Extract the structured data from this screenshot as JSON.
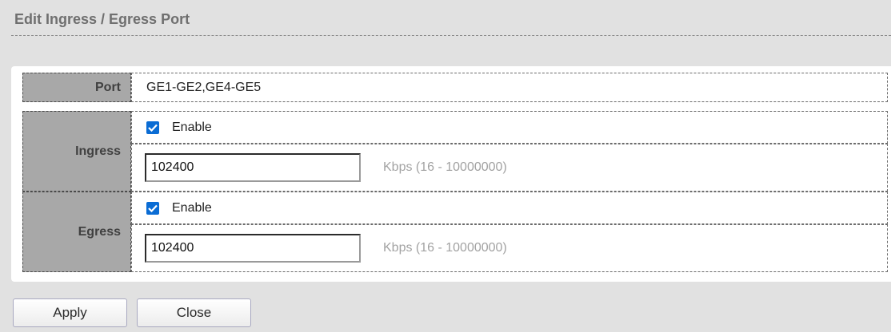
{
  "title": "Edit Ingress / Egress Port",
  "form": {
    "port": {
      "label": "Port",
      "value": "GE1-GE2,GE4-GE5"
    },
    "ingress": {
      "label": "Ingress",
      "enable_label": "Enable",
      "enabled": true,
      "rate_value": "102400",
      "rate_hint": "Kbps (16 - 10000000)"
    },
    "egress": {
      "label": "Egress",
      "enable_label": "Enable",
      "enabled": true,
      "rate_value": "102400",
      "rate_hint": "Kbps (16 - 10000000)"
    }
  },
  "buttons": {
    "apply": "Apply",
    "close": "Close"
  },
  "colors": {
    "checkbox": "#0a6cd4",
    "label_bg": "#a8a8a8",
    "page_bg": "#e1e1e1"
  }
}
